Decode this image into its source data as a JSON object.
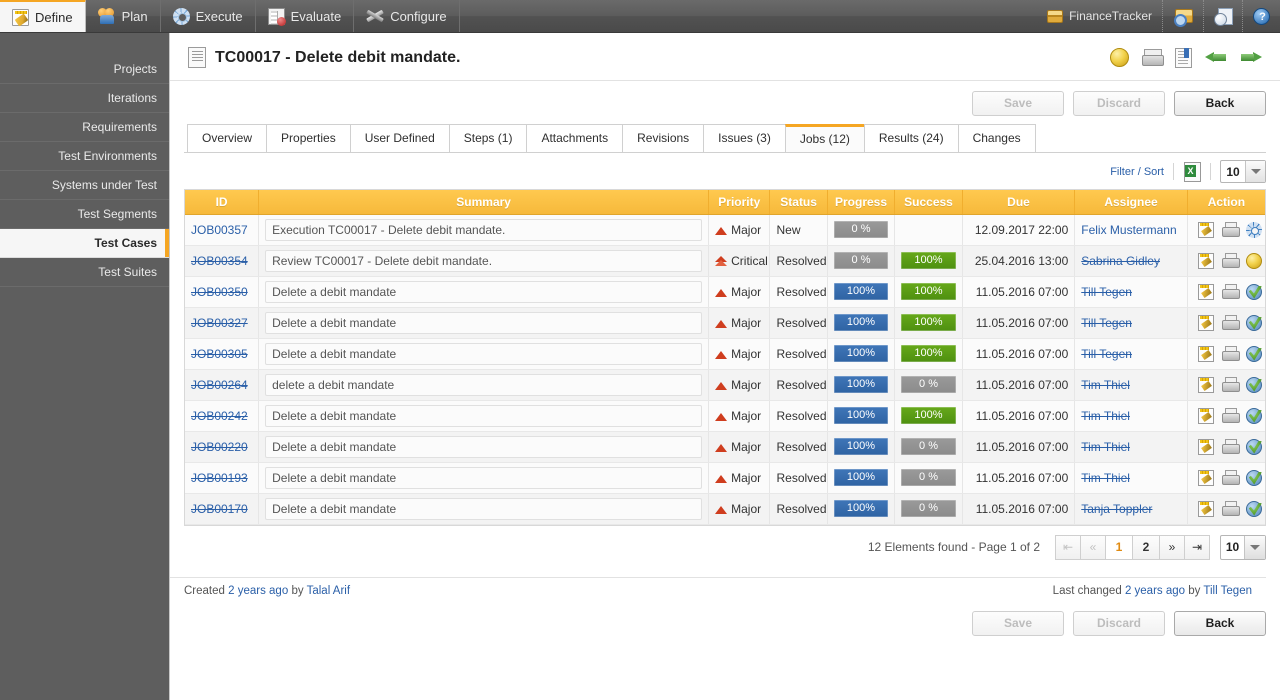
{
  "topnav": {
    "items": [
      {
        "label": "Define",
        "icon": "notepad-pencil-icon",
        "active": true
      },
      {
        "label": "Plan",
        "icon": "people-icon",
        "active": false
      },
      {
        "label": "Execute",
        "icon": "gear-icon",
        "active": false
      },
      {
        "label": "Evaluate",
        "icon": "chart-report-icon",
        "active": false
      },
      {
        "label": "Configure",
        "icon": "tools-icon",
        "active": false
      }
    ],
    "project": "FinanceTracker",
    "right_icons": [
      "box-search-icon",
      "history-icon",
      "help-icon"
    ]
  },
  "sidebar": {
    "items": [
      {
        "label": "Projects",
        "active": false
      },
      {
        "label": "Iterations",
        "active": false
      },
      {
        "label": "Requirements",
        "active": false
      },
      {
        "label": "Test Environments",
        "active": false
      },
      {
        "label": "Systems under Test",
        "active": false
      },
      {
        "label": "Test Segments",
        "active": false
      },
      {
        "label": "Test Cases",
        "active": true
      },
      {
        "label": "Test Suites",
        "active": false
      }
    ]
  },
  "header": {
    "title": "TC00017 - Delete debit mandate.",
    "icons": [
      "dome-icon",
      "print-icon",
      "bookmark-icon",
      "arrow-left-icon",
      "arrow-right-icon"
    ]
  },
  "actions": {
    "save": "Save",
    "discard": "Discard",
    "back": "Back"
  },
  "tabs": [
    {
      "label": "Overview",
      "active": false
    },
    {
      "label": "Properties",
      "active": false
    },
    {
      "label": "User Defined",
      "active": false
    },
    {
      "label": "Steps (1)",
      "active": false
    },
    {
      "label": "Attachments",
      "active": false
    },
    {
      "label": "Revisions",
      "active": false
    },
    {
      "label": "Issues (3)",
      "active": false
    },
    {
      "label": "Jobs (12)",
      "active": true
    },
    {
      "label": "Results (24)",
      "active": false
    },
    {
      "label": "Changes",
      "active": false
    }
  ],
  "grid_tools": {
    "filter_sort": "Filter / Sort",
    "export_icon": "excel-export-icon",
    "page_size": "10"
  },
  "table": {
    "columns": [
      "ID",
      "Summary",
      "Priority",
      "Status",
      "Progress",
      "Success",
      "Due",
      "Assignee",
      "Action"
    ],
    "rows": [
      {
        "id": "JOB00357",
        "id_struck": false,
        "summary": "Execution TC00017 - Delete debit mandate.",
        "priority": "Major",
        "priority_type": "major",
        "status": "New",
        "progress": "0 %",
        "progress_color": "grey",
        "success": "",
        "success_color": "none",
        "due": "12.09.2017 22:00",
        "assignee": "Felix Mustermann",
        "assignee_struck": false,
        "action_icon": "gear-icon"
      },
      {
        "id": "JOB00354",
        "id_struck": true,
        "summary": "Review TC00017 - Delete debit mandate.",
        "priority": "Critical",
        "priority_type": "critical",
        "status": "Resolved",
        "progress": "0 %",
        "progress_color": "grey",
        "success": "100%",
        "success_color": "green",
        "due": "25.04.2016 13:00",
        "assignee": "Sabrina Gidley",
        "assignee_struck": true,
        "action_icon": "dome-icon"
      },
      {
        "id": "JOB00350",
        "id_struck": true,
        "summary": "Delete a debit mandate",
        "priority": "Major",
        "priority_type": "major",
        "status": "Resolved",
        "progress": "100%",
        "progress_color": "blue",
        "success": "100%",
        "success_color": "green",
        "due": "11.05.2016 07:00",
        "assignee": "Till Tegen",
        "assignee_struck": true,
        "action_icon": "globe-check-icon"
      },
      {
        "id": "JOB00327",
        "id_struck": true,
        "summary": "Delete a debit mandate",
        "priority": "Major",
        "priority_type": "major",
        "status": "Resolved",
        "progress": "100%",
        "progress_color": "blue",
        "success": "100%",
        "success_color": "green",
        "due": "11.05.2016 07:00",
        "assignee": "Till Tegen",
        "assignee_struck": true,
        "action_icon": "globe-check-icon"
      },
      {
        "id": "JOB00305",
        "id_struck": true,
        "summary": "Delete a debit mandate",
        "priority": "Major",
        "priority_type": "major",
        "status": "Resolved",
        "progress": "100%",
        "progress_color": "blue",
        "success": "100%",
        "success_color": "green",
        "due": "11.05.2016 07:00",
        "assignee": "Till Tegen",
        "assignee_struck": true,
        "action_icon": "globe-check-icon"
      },
      {
        "id": "JOB00264",
        "id_struck": true,
        "summary": "delete a debit mandate",
        "priority": "Major",
        "priority_type": "major",
        "status": "Resolved",
        "progress": "100%",
        "progress_color": "blue",
        "success": "0 %",
        "success_color": "grey",
        "due": "11.05.2016 07:00",
        "assignee": "Tim Thiel",
        "assignee_struck": true,
        "action_icon": "globe-check-icon"
      },
      {
        "id": "JOB00242",
        "id_struck": true,
        "summary": "Delete a debit mandate",
        "priority": "Major",
        "priority_type": "major",
        "status": "Resolved",
        "progress": "100%",
        "progress_color": "blue",
        "success": "100%",
        "success_color": "green",
        "due": "11.05.2016 07:00",
        "assignee": "Tim Thiel",
        "assignee_struck": true,
        "action_icon": "globe-check-icon"
      },
      {
        "id": "JOB00220",
        "id_struck": true,
        "summary": "Delete a debit mandate",
        "priority": "Major",
        "priority_type": "major",
        "status": "Resolved",
        "progress": "100%",
        "progress_color": "blue",
        "success": "0 %",
        "success_color": "grey",
        "due": "11.05.2016 07:00",
        "assignee": "Tim Thiel",
        "assignee_struck": true,
        "action_icon": "globe-check-icon"
      },
      {
        "id": "JOB00193",
        "id_struck": true,
        "summary": "Delete a debit mandate",
        "priority": "Major",
        "priority_type": "major",
        "status": "Resolved",
        "progress": "100%",
        "progress_color": "blue",
        "success": "0 %",
        "success_color": "grey",
        "due": "11.05.2016 07:00",
        "assignee": "Tim Thiel",
        "assignee_struck": true,
        "action_icon": "globe-check-icon"
      },
      {
        "id": "JOB00170",
        "id_struck": true,
        "summary": "Delete a debit mandate",
        "priority": "Major",
        "priority_type": "major",
        "status": "Resolved",
        "progress": "100%",
        "progress_color": "blue",
        "success": "0 %",
        "success_color": "grey",
        "due": "11.05.2016 07:00",
        "assignee": "Tanja Toppler",
        "assignee_struck": true,
        "action_icon": "globe-check-icon"
      }
    ]
  },
  "pagination": {
    "info": "12 Elements found - Page 1 of 2",
    "first": "⇤",
    "prev": "«",
    "pages": [
      "1",
      "2"
    ],
    "active_page": "1",
    "next": "»",
    "last": "⇥",
    "page_size": "10"
  },
  "footer": {
    "created_prefix": "Created",
    "created_when": "2 years ago",
    "created_by_prefix": "by",
    "created_by": "Talal Arif",
    "changed_prefix": "Last changed",
    "changed_when": "2 years ago",
    "changed_by_prefix": "by",
    "changed_by": "Till Tegen"
  },
  "colors": {
    "accent_orange": "#f5a623",
    "header_orange": "#f6b93b",
    "link_blue": "#2a5fa8",
    "bar_blue": "#3f76b8",
    "bar_green": "#66a81a",
    "bar_grey": "#9a9a9a"
  }
}
